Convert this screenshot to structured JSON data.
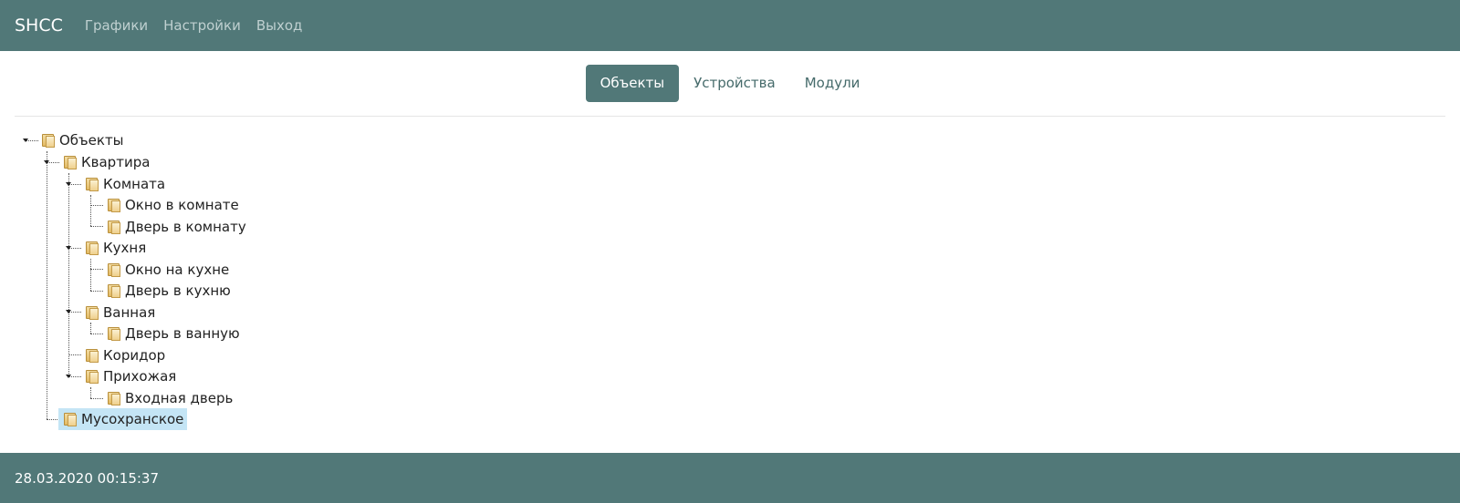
{
  "navbar": {
    "brand": "SHCC",
    "links": [
      "Графики",
      "Настройки",
      "Выход"
    ]
  },
  "tabs": [
    "Объекты",
    "Устройства",
    "Модули"
  ],
  "active_tab": "Объекты",
  "tree": {
    "root": "Объекты",
    "apartment": "Квартира",
    "room": "Комната",
    "room_window": "Окно в комнате",
    "room_door": "Дверь в комнату",
    "kitchen": "Кухня",
    "kitchen_window": "Окно на кухне",
    "kitchen_door": "Дверь в кухню",
    "bathroom": "Ванная",
    "bathroom_door": "Дверь в ванную",
    "corridor": "Коридор",
    "hallway": "Прихожая",
    "front_door": "Входная дверь",
    "garbage": "Мусохранское",
    "selected": "Мусохранское"
  },
  "footer": {
    "datetime": "28.03.2020 00:15:37"
  },
  "colors": {
    "accent": "#517878",
    "selected_bg": "#c4e5f5"
  }
}
